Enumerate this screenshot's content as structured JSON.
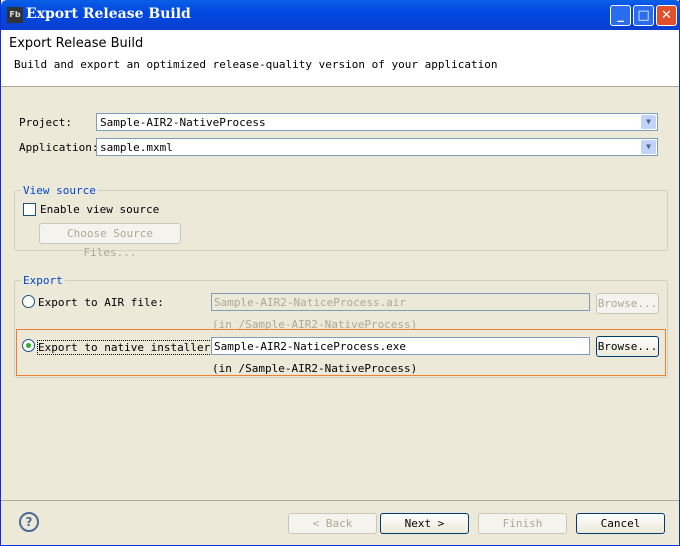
{
  "window": {
    "title": "Export Release Build",
    "app_icon": "Fb",
    "controls": {
      "minimize": "_",
      "maximize": "□",
      "close": "✕"
    }
  },
  "header": {
    "title": "Export Release Build",
    "description": "Build and export an optimized release-quality version of your application"
  },
  "project": {
    "label": "Project:",
    "value": "Sample-AIR2-NativeProcess"
  },
  "application": {
    "label": "Application:",
    "value": "sample.mxml"
  },
  "view_source": {
    "group_label": "View source",
    "checkbox_label": "Enable view source",
    "checked": false,
    "choose_button": "Choose Source Files..."
  },
  "export": {
    "group_label": "Export",
    "air": {
      "label": "Export to AIR file:",
      "selected": false,
      "value": "Sample-AIR2-NaticeProcess.air",
      "hint": "(in /Sample-AIR2-NativeProcess)",
      "browse": "Browse..."
    },
    "native": {
      "label": "Export to native installer:",
      "selected": true,
      "value": "Sample-AIR2-NaticeProcess.exe",
      "hint": "(in /Sample-AIR2-NativeProcess)",
      "browse": "Browse..."
    }
  },
  "footer": {
    "help": "?",
    "back": "< Back",
    "next": "Next >",
    "finish": "Finish",
    "cancel": "Cancel"
  }
}
